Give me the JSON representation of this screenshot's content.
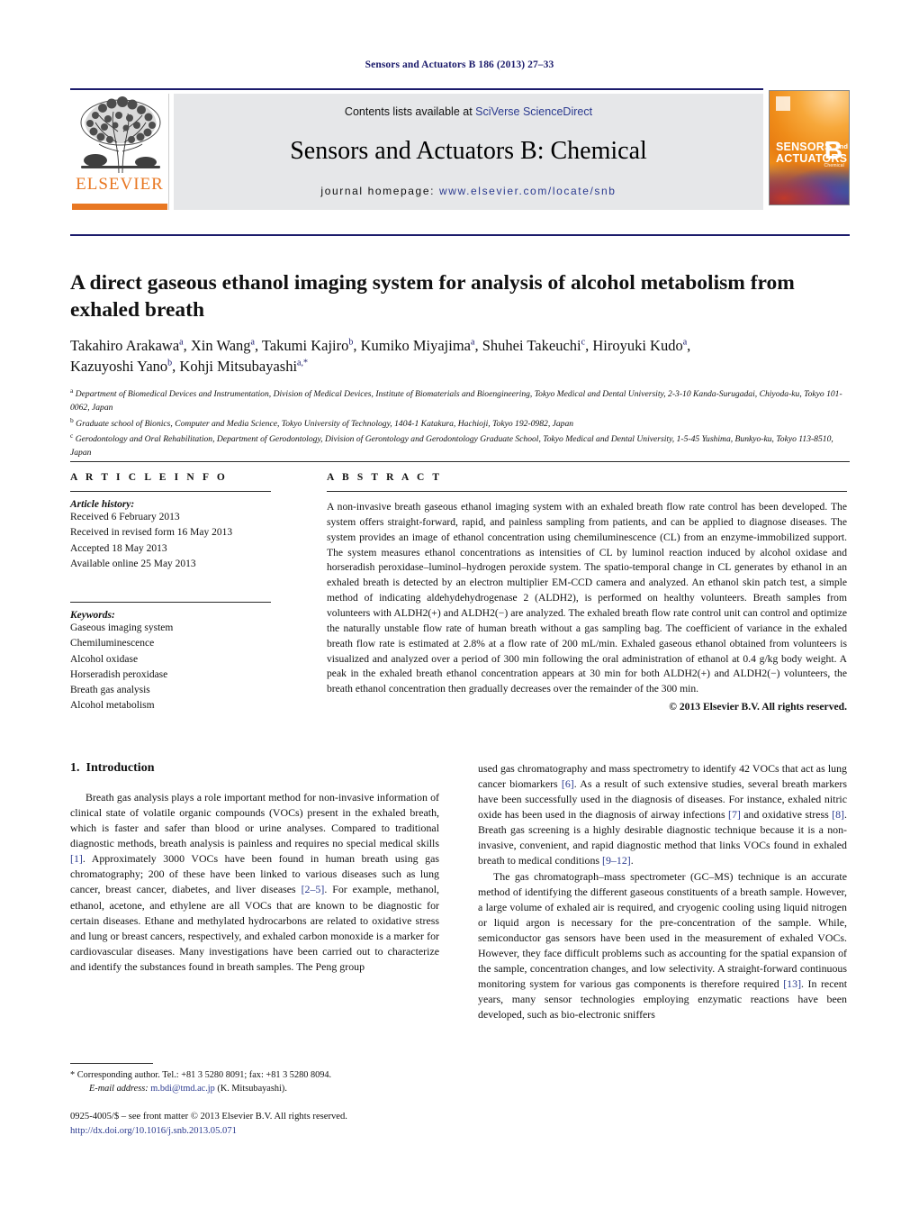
{
  "running_head": "Sensors and Actuators B 186 (2013) 27–33",
  "masthead": {
    "contents_prefix": "Contents lists available at ",
    "contents_link": "SciVerse ScienceDirect",
    "journal_title": "Sensors and Actuators B: Chemical",
    "homepage_prefix": "journal homepage: ",
    "homepage_link": "www.elsevier.com/locate/snb",
    "publisher_name": "ELSEVIER",
    "cover": {
      "line1": "SENSORS",
      "and": "and",
      "line2": "ACTUATORS",
      "volume_letter": "B",
      "volume_sub": "Chemical"
    }
  },
  "article": {
    "title": "A direct gaseous ethanol imaging system for analysis of alcohol metabolism from exhaled breath",
    "authors_line1": "Takahiro Arakawa a, Xin Wang a, Takumi Kajiro b, Kumiko Miyajima a, Shuhei Takeuchi c, Hiroyuki Kudo a,",
    "authors_line2": "Kazuyoshi Yano b, Kohji Mitsubayashi a,*",
    "affiliations": [
      {
        "marker": "a",
        "text": "Department of Biomedical Devices and Instrumentation, Division of Medical Devices, Institute of Biomaterials and Bioengineering, Tokyo Medical and Dental University, 2-3-10 Kanda-Surugadai, Chiyoda-ku, Tokyo 101-0062, Japan"
      },
      {
        "marker": "b",
        "text": "Graduate school of Bionics, Computer and Media Science, Tokyo University of Technology, 1404-1 Katakura, Hachioji, Tokyo 192-0982, Japan"
      },
      {
        "marker": "c",
        "text": "Gerodontology and Oral Rehabilitation, Department of Gerodontology, Division of Gerontology and Gerodontology Graduate School, Tokyo Medical and Dental University, 1-5-45 Yushima, Bunkyo-ku, Tokyo 113-8510, Japan"
      }
    ]
  },
  "article_info": {
    "heading": "A R T I C L E    I N F O",
    "history_label": "Article history:",
    "history": [
      "Received 6 February 2013",
      "Received in revised form 16 May 2013",
      "Accepted 18 May 2013",
      "Available online 25 May 2013"
    ],
    "keywords_label": "Keywords:",
    "keywords": [
      "Gaseous imaging system",
      "Chemiluminescence",
      "Alcohol oxidase",
      "Horseradish peroxidase",
      "Breath gas analysis",
      "Alcohol metabolism"
    ]
  },
  "abstract": {
    "heading": "A B S T R A C T",
    "text": "A non-invasive breath gaseous ethanol imaging system with an exhaled breath flow rate control has been developed. The system offers straight-forward, rapid, and painless sampling from patients, and can be applied to diagnose diseases. The system provides an image of ethanol concentration using chemiluminescence (CL) from an enzyme-immobilized support. The system measures ethanol concentrations as intensities of CL by luminol reaction induced by alcohol oxidase and horseradish peroxidase–luminol–hydrogen peroxide system. The spatio-temporal change in CL generates by ethanol in an exhaled breath is detected by an electron multiplier EM-CCD camera and analyzed. An ethanol skin patch test, a simple method of indicating aldehydehydrogenase 2 (ALDH2), is performed on healthy volunteers. Breath samples from volunteers with ALDH2(+) and ALDH2(−) are analyzed. The exhaled breath flow rate control unit can control and optimize the naturally unstable flow rate of human breath without a gas sampling bag. The coefficient of variance in the exhaled breath flow rate is estimated at 2.8% at a flow rate of 200 mL/min. Exhaled gaseous ethanol obtained from volunteers is visualized and analyzed over a period of 300 min following the oral administration of ethanol at 0.4 g/kg body weight. A peak in the exhaled breath ethanol concentration appears at 30 min for both ALDH2(+) and ALDH2(−) volunteers, the breath ethanol concentration then gradually decreases over the remainder of the 300 min.",
    "copyright": "© 2013 Elsevier B.V. All rights reserved."
  },
  "intro": {
    "number": "1.",
    "heading": "Introduction",
    "left_paragraph_1_a": "Breath gas analysis plays a role important method for non-invasive information of clinical state of volatile organic compounds (VOCs) present in the exhaled breath, which is faster and safer than blood or urine analyses. Compared to traditional diagnostic methods, breath analysis is painless and requires no special medical skills ",
    "left_ref_1": "[1]",
    "left_paragraph_1_b": ". Approximately 3000 VOCs have been found in human breath using gas chromatography; 200 of these have been linked to various diseases such as lung cancer, breast cancer, diabetes, and liver diseases ",
    "left_ref_2": "[2–5]",
    "left_paragraph_1_c": ". For example, methanol, ethanol, acetone, and ethylene are all VOCs that are known to be diagnostic for certain diseases. Ethane and methylated hydrocarbons are related to oxidative stress and lung or breast cancers, respectively, and exhaled carbon monoxide is a marker for cardiovascular diseases. Many investigations have been carried out to characterize and identify the substances found in breath samples. The Peng group",
    "right_paragraph_1_a": "used gas chromatography and mass spectrometry to identify 42 VOCs that act as lung cancer biomarkers ",
    "right_ref_6": "[6]",
    "right_paragraph_1_b": ". As a result of such extensive studies, several breath markers have been successfully used in the diagnosis of diseases. For instance, exhaled nitric oxide has been used in the diagnosis of airway infections ",
    "right_ref_7": "[7]",
    "right_paragraph_1_c": " and oxidative stress ",
    "right_ref_8": "[8]",
    "right_paragraph_1_d": ". Breath gas screening is a highly desirable diagnostic technique because it is a non-invasive, convenient, and rapid diagnostic method that links VOCs found in exhaled breath to medical conditions ",
    "right_ref_9": "[9–12]",
    "right_paragraph_1_e": ".",
    "right_paragraph_2_a": "The gas chromatograph–mass spectrometer (GC–MS) technique is an accurate method of identifying the different gaseous constituents of a breath sample. However, a large volume of exhaled air is required, and cryogenic cooling using liquid nitrogen or liquid argon is necessary for the pre-concentration of the sample. While, semiconductor gas sensors have been used in the measurement of exhaled VOCs. However, they face difficult problems such as accounting for the spatial expansion of the sample, concentration changes, and low selectivity. A straight-forward continuous monitoring system for various gas components is therefore required ",
    "right_ref_13": "[13]",
    "right_paragraph_2_b": ". In recent years, many sensor technologies employing enzymatic reactions have been developed, such as bio-electronic sniffers"
  },
  "footnotes": {
    "corresponding": "* Corresponding author. Tel.: +81 3 5280 8091; fax: +81 3 5280 8094.",
    "email_label": "E-mail address:",
    "email": "m.bdi@tmd.ac.jp",
    "email_owner": "(K. Mitsubayashi).",
    "issn_line": "0925-4005/$ – see front matter © 2013 Elsevier B.V. All rights reserved.",
    "doi": "http://dx.doi.org/10.1016/j.snb.2013.05.071"
  },
  "colors": {
    "navy": "#1b1b6b",
    "link": "#2b3a8f",
    "elsevier_orange": "#e87722",
    "band_gray": "#e6e7e9"
  }
}
